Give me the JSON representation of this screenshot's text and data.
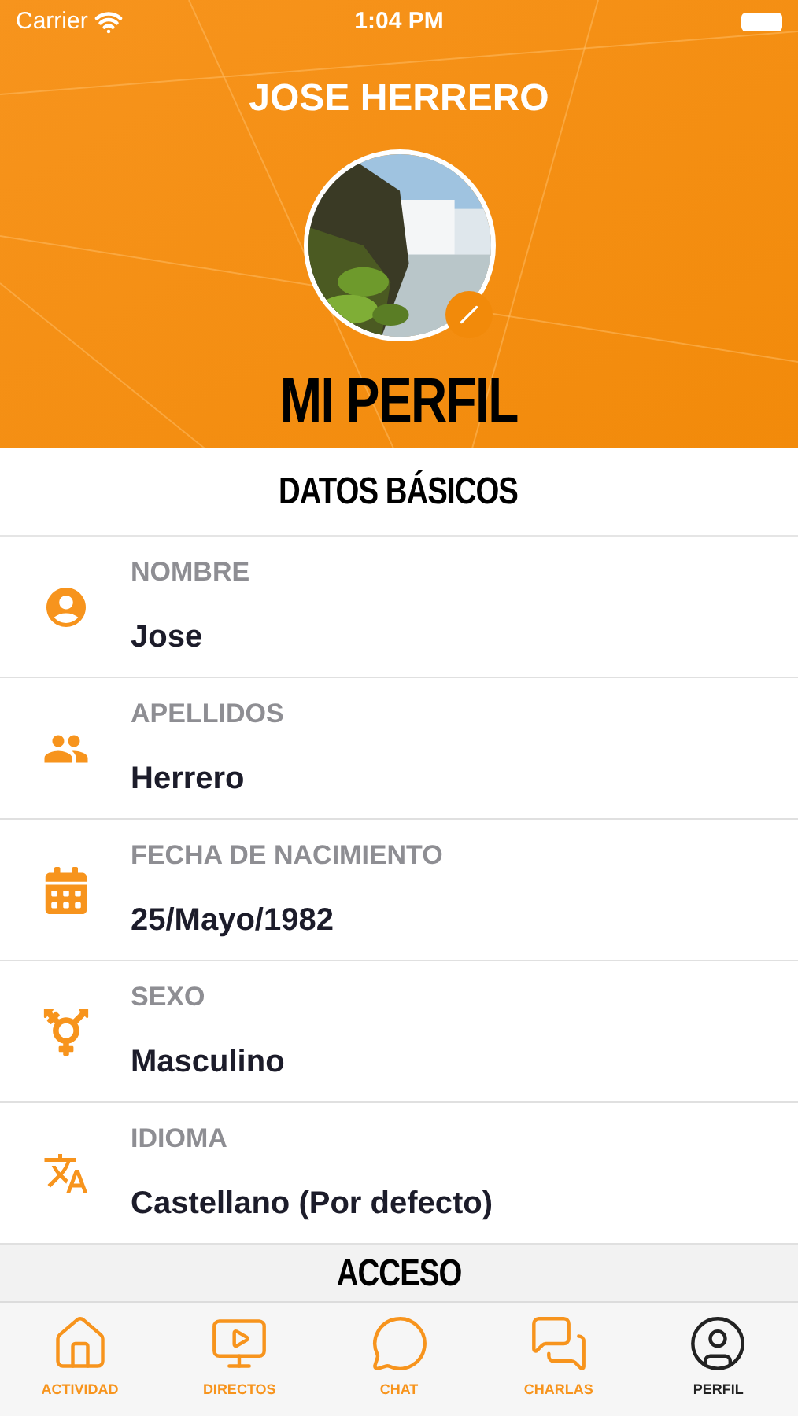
{
  "status_bar": {
    "carrier": "Carrier",
    "time": "1:04 PM"
  },
  "header": {
    "user_name": "JOSE HERRERO",
    "title": "MI PERFIL"
  },
  "sections": [
    {
      "title": "DATOS BÁSICOS",
      "fields": [
        {
          "label": "NOMBRE",
          "value": "Jose"
        },
        {
          "label": "APELLIDOS",
          "value": "Herrero"
        },
        {
          "label": "FECHA DE NACIMIENTO",
          "value": "25/Mayo/1982"
        },
        {
          "label": "SEXO",
          "value": "Masculino"
        },
        {
          "label": "IDIOMA",
          "value": "Castellano (Por defecto)"
        }
      ]
    },
    {
      "title": "ACCESO"
    }
  ],
  "tab_bar": [
    {
      "label": "ACTIVIDAD",
      "selected": false
    },
    {
      "label": "DIRECTOS",
      "selected": false
    },
    {
      "label": "CHAT",
      "selected": false
    },
    {
      "label": "CHARLAS",
      "selected": false
    },
    {
      "label": "PERFIL",
      "selected": true
    }
  ]
}
